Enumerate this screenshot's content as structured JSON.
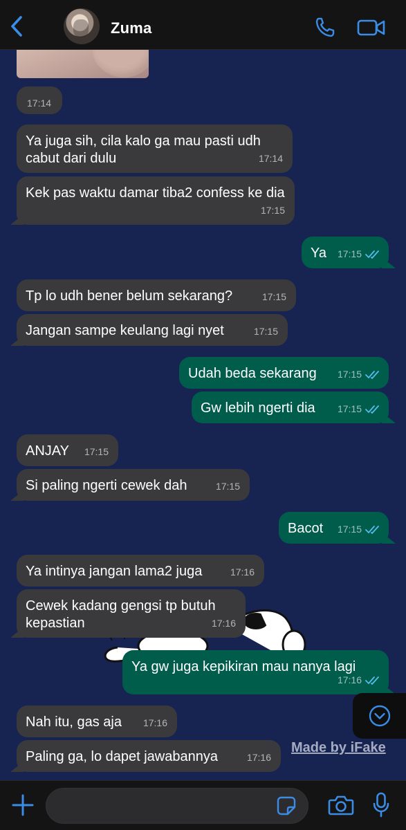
{
  "header": {
    "contact_name": "Zuma",
    "accent": "#3a8ce6"
  },
  "timestamp_pill": "17:14",
  "messages": [
    {
      "dir": "in",
      "text": "Ya juga sih, cila kalo ga mau pasti udh cabut dari dulu",
      "time": "17:14"
    },
    {
      "dir": "in",
      "text": "Kek pas waktu damar tiba2 confess ke dia",
      "time": "17:15"
    },
    {
      "dir": "out",
      "text": "Ya",
      "time": "17:15",
      "status": "read"
    },
    {
      "dir": "in",
      "text": "Tp lo udh bener belum sekarang?",
      "time": "17:15"
    },
    {
      "dir": "in",
      "text": "Jangan sampe keulang lagi nyet",
      "time": "17:15"
    },
    {
      "dir": "out",
      "text": "Udah beda sekarang",
      "time": "17:15",
      "status": "read"
    },
    {
      "dir": "out",
      "text": "Gw lebih ngerti dia",
      "time": "17:15",
      "status": "read"
    },
    {
      "dir": "in",
      "text": "ANJAY",
      "time": "17:15"
    },
    {
      "dir": "in",
      "text": "Si paling ngerti cewek dah",
      "time": "17:15"
    },
    {
      "dir": "out",
      "text": "Bacot",
      "time": "17:15",
      "status": "read"
    },
    {
      "dir": "in",
      "text": "Ya intinya jangan lama2 juga",
      "time": "17:16"
    },
    {
      "dir": "in",
      "text": "Cewek kadang gengsi tp butuh kepastian",
      "time": "17:16"
    },
    {
      "dir": "out",
      "text": "Ya gw juga kepikiran mau nanya lagi",
      "time": "17:16",
      "status": "read"
    },
    {
      "dir": "in",
      "text": "Nah itu, gas aja",
      "time": "17:16"
    },
    {
      "dir": "in",
      "text": "Paling ga, lo dapet jawabannya",
      "time": "17:16"
    }
  ],
  "watermark": "Made by iFake",
  "colors": {
    "chat_background": "#172452",
    "incoming_bubble": "#3a3a3c",
    "outgoing_bubble": "#005c4b",
    "read_ticks": "#53bdeb"
  },
  "icons": [
    "back-arrow-icon",
    "phone-icon",
    "video-camera-icon",
    "chevron-down-icon",
    "plus-icon",
    "sticker-icon",
    "camera-icon",
    "microphone-icon"
  ]
}
